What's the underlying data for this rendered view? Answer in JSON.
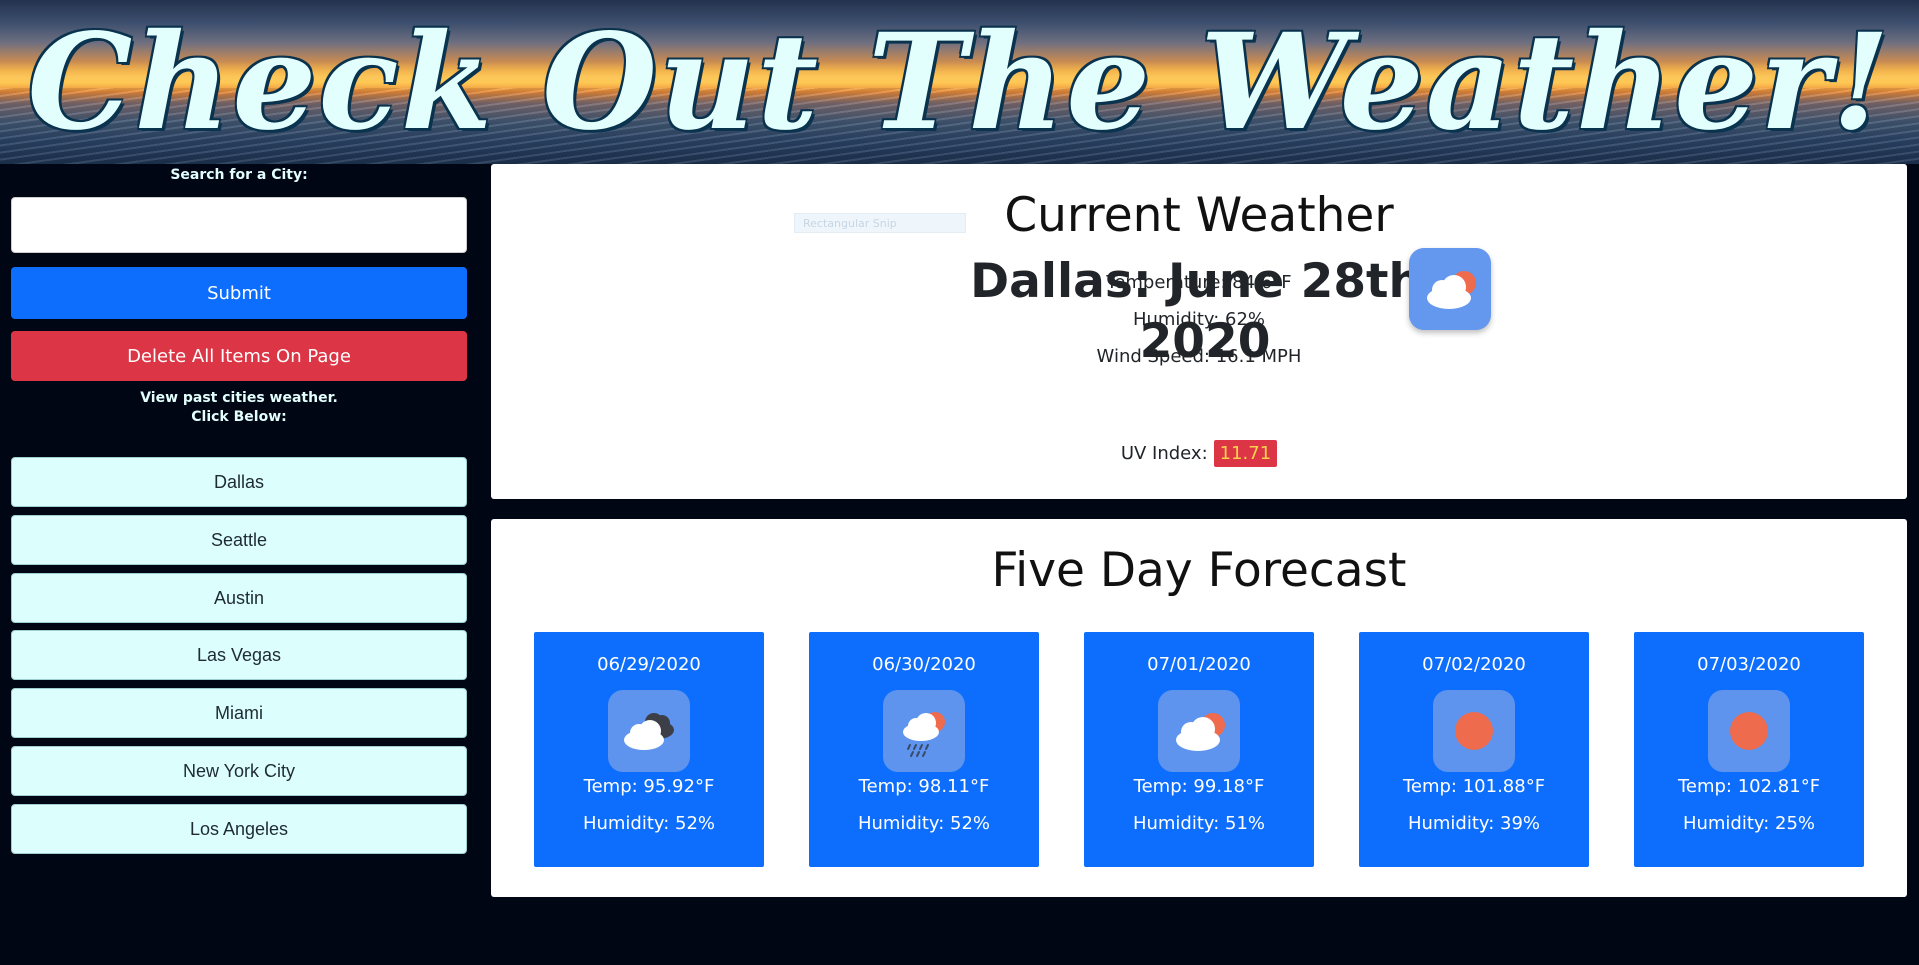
{
  "banner": {
    "title": "Check Out The Weather!"
  },
  "sidebar": {
    "search_label": "Search for a City:",
    "search_value": "",
    "submit_label": "Submit",
    "delete_label": "Delete All Items On Page",
    "past_line1": "View past cities weather.",
    "past_line2": "Click Below:",
    "cities": [
      "Dallas",
      "Seattle",
      "Austin",
      "Las Vegas",
      "Miami",
      "New York City",
      "Los Angeles"
    ]
  },
  "current": {
    "title": "Current Weather",
    "city_date": "Dallas: June 28th, 2020",
    "icon": "partly-cloudy-sun-icon",
    "temperature": "Temperature: 84.6°F",
    "humidity": "Humidity: 62%",
    "wind": "Wind Speed: 16.1 MPH",
    "uv_label": "UV Index:",
    "uv_value": "11.71",
    "snip_artifact": "Rectangular Snip"
  },
  "forecast": {
    "title": "Five Day Forecast",
    "days": [
      {
        "date": "06/29/2020",
        "icon": "broken-clouds-icon",
        "temp": "Temp: 95.92°F",
        "humidity": "Humidity: 52%"
      },
      {
        "date": "06/30/2020",
        "icon": "rain-sun-icon",
        "temp": "Temp: 98.11°F",
        "humidity": "Humidity: 52%"
      },
      {
        "date": "07/01/2020",
        "icon": "partly-cloudy-sun-icon",
        "temp": "Temp: 99.18°F",
        "humidity": "Humidity: 51%"
      },
      {
        "date": "07/02/2020",
        "icon": "sun-icon",
        "temp": "Temp: 101.88°F",
        "humidity": "Humidity: 39%"
      },
      {
        "date": "07/03/2020",
        "icon": "sun-icon",
        "temp": "Temp: 102.81°F",
        "humidity": "Humidity: 25%"
      }
    ]
  },
  "colors": {
    "page_bg": "#010614",
    "primary": "#0d6efd",
    "danger": "#dc3545",
    "city_button": "#dcfffe",
    "icon_tile": "#6497ee",
    "sun": "#ee6b4d"
  }
}
